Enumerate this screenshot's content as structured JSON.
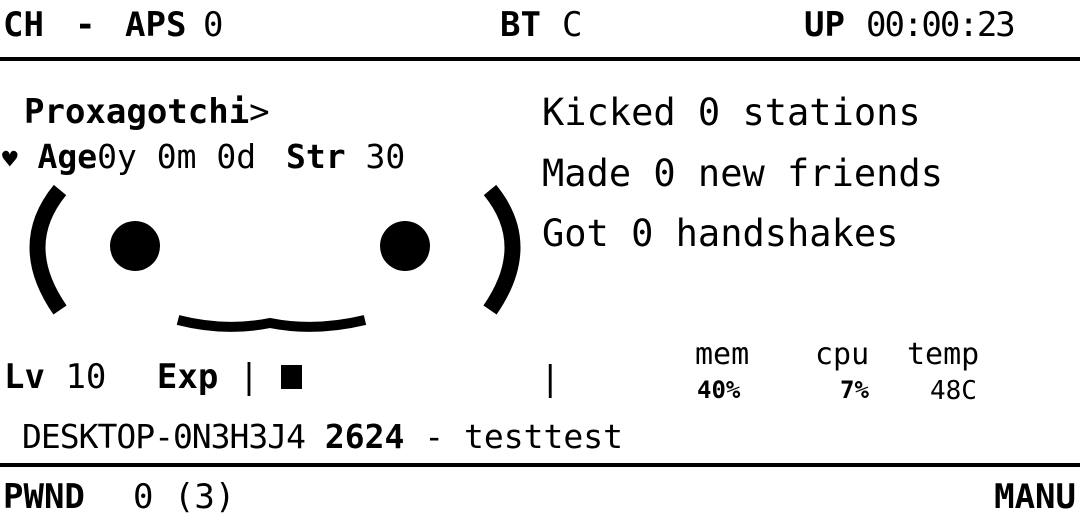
{
  "header": {
    "channel_label": "CH",
    "channel_value": "-",
    "aps_label": "APS",
    "aps_value": "0",
    "bt_label": "BT",
    "bt_value": "C",
    "uptime_label": "UP",
    "uptime_value": "00:00:23"
  },
  "pet": {
    "name": "Proxagotchi",
    "name_suffix": ">",
    "heart": "♥",
    "age_label": "Age",
    "age_value": "0y 0m 0d",
    "str_label": "Str",
    "str_value": "30",
    "level_label": "Lv",
    "level_value": "10",
    "exp_label": "Exp",
    "exp_bar_start": "|",
    "exp_fraction": 0.05
  },
  "status": {
    "lines": [
      "Kicked 0 stations",
      "Made 0 new friends",
      "Got 0 handshakes"
    ]
  },
  "stats": {
    "divider": "|",
    "headers": [
      "mem",
      "cpu",
      "temp"
    ],
    "values": [
      "40%",
      "7%",
      "48C"
    ]
  },
  "host_line": {
    "host": "DESKTOP-0N3H3J4",
    "port": "2624",
    "sep": "-",
    "user": "testtest"
  },
  "footer": {
    "pwnd_label": "PWND",
    "pwnd_value": "0 (3)",
    "mode": "MANU"
  }
}
